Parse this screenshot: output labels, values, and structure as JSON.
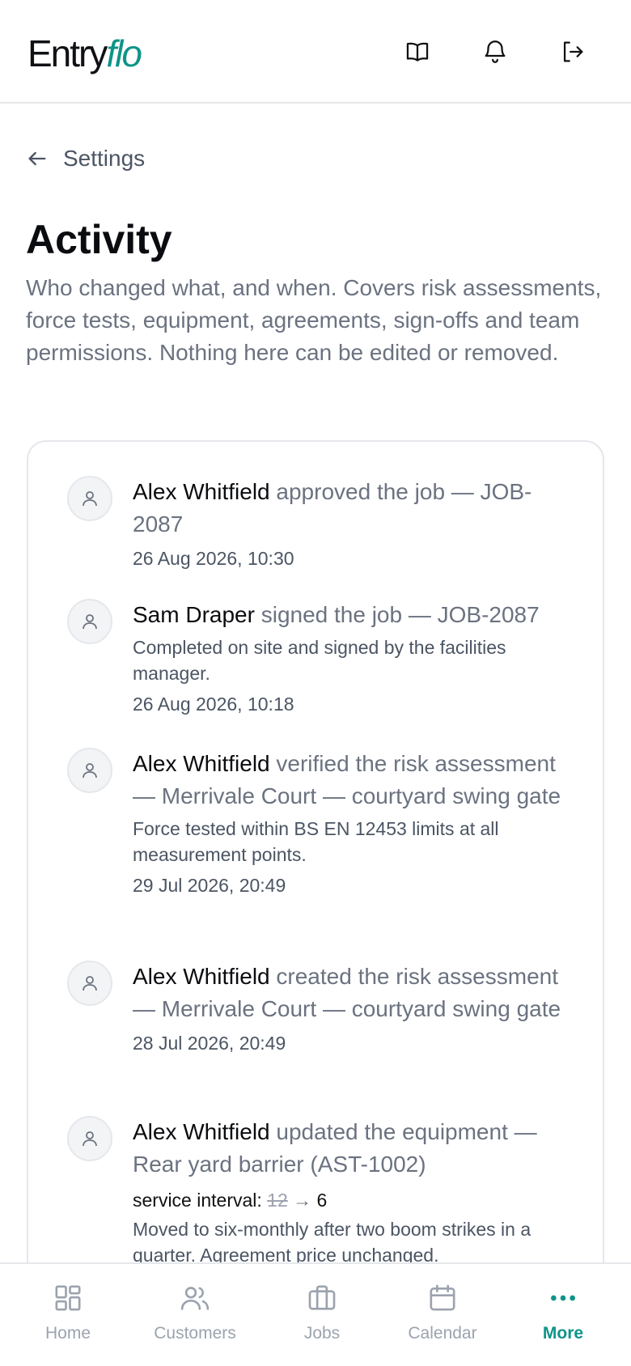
{
  "brand": {
    "part1": "Entry",
    "part2": "flo",
    "accent": "#0e9488"
  },
  "header": {
    "icons": [
      "book-icon",
      "bell-icon",
      "logout-icon"
    ]
  },
  "back": {
    "label": "Settings"
  },
  "page": {
    "title": "Activity",
    "description": "Who changed what, and when. Covers risk assessments, force tests, equipment, agreements, sign-offs and team permissions. Nothing here can be edited or removed."
  },
  "entries": [
    {
      "actor": "Alex Whitfield",
      "action": " approved the job — JOB-2087",
      "time": "26 Aug 2026, 10:30"
    },
    {
      "actor": "Sam Draper",
      "action": " signed the job — JOB-2087",
      "note": "Completed on site and signed by the facilities manager.",
      "time": "26 Aug 2026, 10:18"
    },
    {
      "actor": "Alex Whitfield",
      "action": " verified the risk assessment — Merrivale Court — courtyard swing gate",
      "note": "Force tested within BS EN 12453 limits at all measurement points.",
      "time": "29 Jul 2026, 20:49"
    },
    {
      "actor": "Alex Whitfield",
      "action": " created the risk assessment — Merrivale Court — courtyard swing gate",
      "time": "28 Jul 2026, 20:49"
    },
    {
      "actor": "Alex Whitfield",
      "action": " updated the equipment — Rear yard barrier (AST-1002)",
      "change_field": "service interval:",
      "change_old": "12",
      "change_arrow": "→",
      "change_new": "6",
      "note": "Moved to six-monthly after two boom strikes in a quarter. Agreement price unchanged."
    }
  ],
  "nav": {
    "items": [
      {
        "label": "Home",
        "icon": "grid-icon"
      },
      {
        "label": "Customers",
        "icon": "users-icon"
      },
      {
        "label": "Jobs",
        "icon": "briefcase-icon"
      },
      {
        "label": "Calendar",
        "icon": "calendar-icon"
      },
      {
        "label": "More",
        "icon": "more-icon",
        "active": true
      }
    ]
  }
}
